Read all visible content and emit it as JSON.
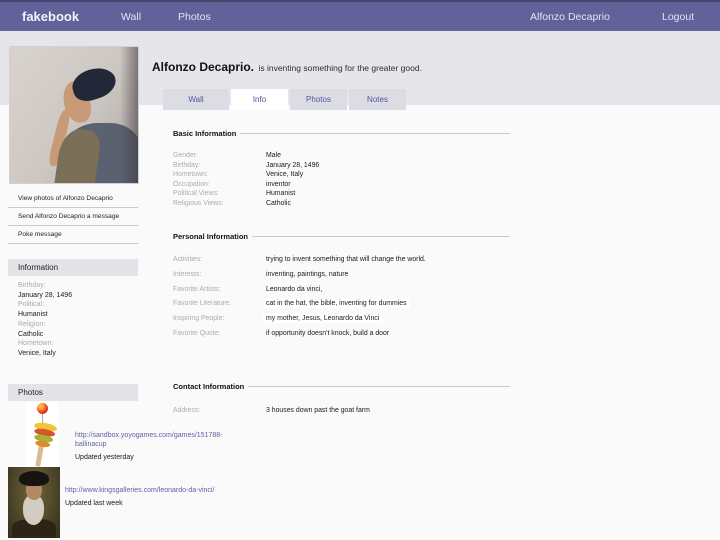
{
  "navbar": {
    "brand": "fakebook",
    "left_links": [
      "Wall",
      "Photos"
    ],
    "right_links": [
      "Alfonzo Decaprio",
      "Logout"
    ]
  },
  "profile": {
    "name": "Alfonzo Decaprio.",
    "status": "is inventing something for the greater good.",
    "tabs": [
      {
        "label": "Wall",
        "active": false
      },
      {
        "label": "Info",
        "active": true
      },
      {
        "label": "Photos",
        "active": false
      },
      {
        "label": "Notes",
        "active": false
      }
    ]
  },
  "sidebar": {
    "actions": [
      "View photos of Alfonzo Decaprio",
      "Send Alfonzo Decaprio a message",
      "Poke message"
    ],
    "information": {
      "title": "Information",
      "fields": [
        {
          "label": "Birthday:",
          "value": "January 28, 1496"
        },
        {
          "label": "Political:",
          "value": "Humanist"
        },
        {
          "label": "Religion:",
          "value": "Catholic"
        },
        {
          "label": "Hometown:",
          "value": "Venice, Italy"
        }
      ]
    },
    "photos_title": "Photos"
  },
  "sections": {
    "basic": {
      "title": "Basic Information",
      "rows": [
        {
          "label": "Gender:",
          "value": "Male"
        },
        {
          "label": "Birthday:",
          "value": "January 28,  1496"
        },
        {
          "label": "Hometown:",
          "value": "Venice, Italy"
        },
        {
          "label": "Occupation:",
          "value": "inventor"
        },
        {
          "label": "Political Views:",
          "value": "Humanist"
        },
        {
          "label": "Religious Views:",
          "value": "Catholic"
        }
      ]
    },
    "personal": {
      "title": "Personal Information",
      "rows": [
        {
          "label": "Activities:",
          "value": "trying to invent something that will change the world."
        },
        {
          "label": "Interests:",
          "value": "inventing, paintings, nature"
        },
        {
          "label": "Favorite Artists:",
          "value": "Leonardo da vinci,"
        },
        {
          "label": "Favorite Literature:",
          "value": "cat in the hat, the bible, inventing for dummies"
        },
        {
          "label": "Inspiring People:",
          "value": "my mother,  Jesus, Leonardo da Vinci"
        },
        {
          "label": "Favorite Quote:",
          "value": "if opportunity doesn't knock, build a door"
        }
      ]
    },
    "contact": {
      "title": "Contact Information",
      "rows": [
        {
          "label": "Address:",
          "value": "3 houses down past the goat farm"
        }
      ]
    }
  },
  "photo_feed": [
    {
      "image": "ball-in-a-cup-toy",
      "url": "http://sandbox.yoyogames.com/games/151788-ballinacup",
      "updated": "Updated yesterday"
    },
    {
      "image": "leonardo-da-vinci-portrait",
      "url": "http://www.kingsgalleries.com/leonardo-da-vinci/",
      "updated": "Updated last week"
    }
  ],
  "colors": {
    "navbar_bg": "#62629B",
    "navbar_top_edge": "#474770",
    "band_bg": "#E5E5EA",
    "tab_inactive_bg": "#DCDCE5",
    "tab_text": "#54549A",
    "link": "#6161A3",
    "field_label": "#ABABB3",
    "sidebar_header_bg": "#E3E3E8"
  }
}
